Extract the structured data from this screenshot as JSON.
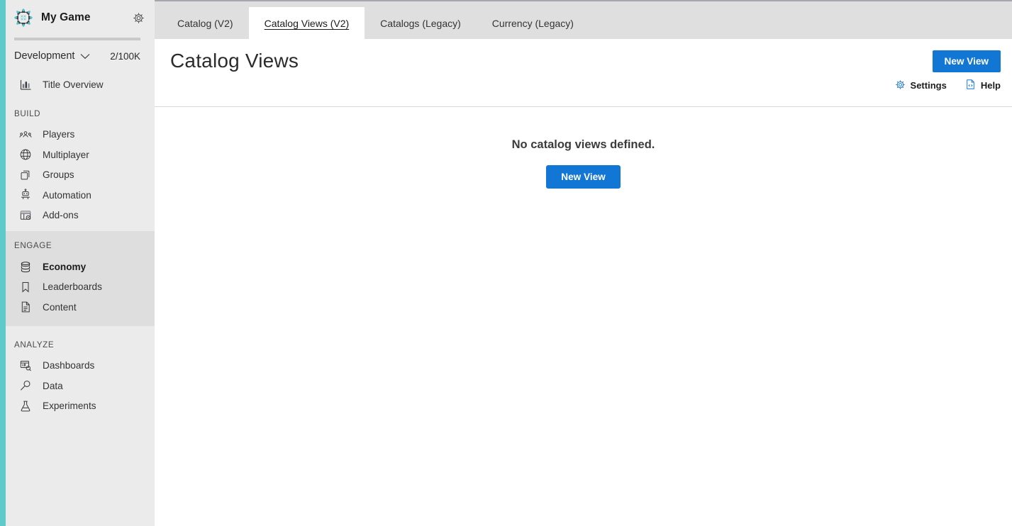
{
  "colors": {
    "teal_rail": "#5ECACA",
    "accent_blue": "#1277d4",
    "selection_blue": "#0f6cbd",
    "sidebar_bg": "#ebebeb",
    "sidebar_section_bg": "#dedede",
    "tabbar_bg": "#dfdfdf"
  },
  "sidebar": {
    "logo_icon": "game-logo-icon",
    "game_title": "My Game",
    "settings_icon": "gear-icon",
    "environment": {
      "name": "Development",
      "caret_icon": "chevron-down-icon",
      "quota": "2/100K",
      "progress_percent": 0
    },
    "top_items": [
      {
        "label": "Title Overview",
        "icon": "bar-chart-icon",
        "active": false
      }
    ],
    "groups": [
      {
        "heading": "BUILD",
        "shaded": false,
        "items": [
          {
            "label": "Players",
            "icon": "players-icon",
            "active": false
          },
          {
            "label": "Multiplayer",
            "icon": "globe-icon",
            "active": false
          },
          {
            "label": "Groups",
            "icon": "copy-stack-icon",
            "active": false
          },
          {
            "label": "Automation",
            "icon": "robot-icon",
            "active": false
          },
          {
            "label": "Add-ons",
            "icon": "addons-grid-icon",
            "active": false
          }
        ]
      },
      {
        "heading": "ENGAGE",
        "shaded": true,
        "items": [
          {
            "label": "Economy",
            "icon": "coin-stack-icon",
            "active": true
          },
          {
            "label": "Leaderboards",
            "icon": "bookmark-icon",
            "active": false
          },
          {
            "label": "Content",
            "icon": "document-icon",
            "active": false
          }
        ]
      },
      {
        "heading": "ANALYZE",
        "shaded": false,
        "items": [
          {
            "label": "Dashboards",
            "icon": "dashboard-icon",
            "active": false
          },
          {
            "label": "Data",
            "icon": "magnifier-icon",
            "active": false
          },
          {
            "label": "Experiments",
            "icon": "flask-icon",
            "active": false
          }
        ]
      }
    ]
  },
  "tabs": [
    {
      "label": "Catalog (V2)",
      "active": false
    },
    {
      "label": "Catalog Views (V2)",
      "active": true
    },
    {
      "label": "Catalogs (Legacy)",
      "active": false
    },
    {
      "label": "Currency (Legacy)",
      "active": false
    }
  ],
  "page": {
    "title": "Catalog Views",
    "new_view_label": "New View",
    "actions": [
      {
        "label": "Settings",
        "icon": "gear-icon"
      },
      {
        "label": "Help",
        "icon": "help-document-icon"
      }
    ]
  },
  "empty_state": {
    "message": "No catalog views defined.",
    "button_label": "New View"
  }
}
